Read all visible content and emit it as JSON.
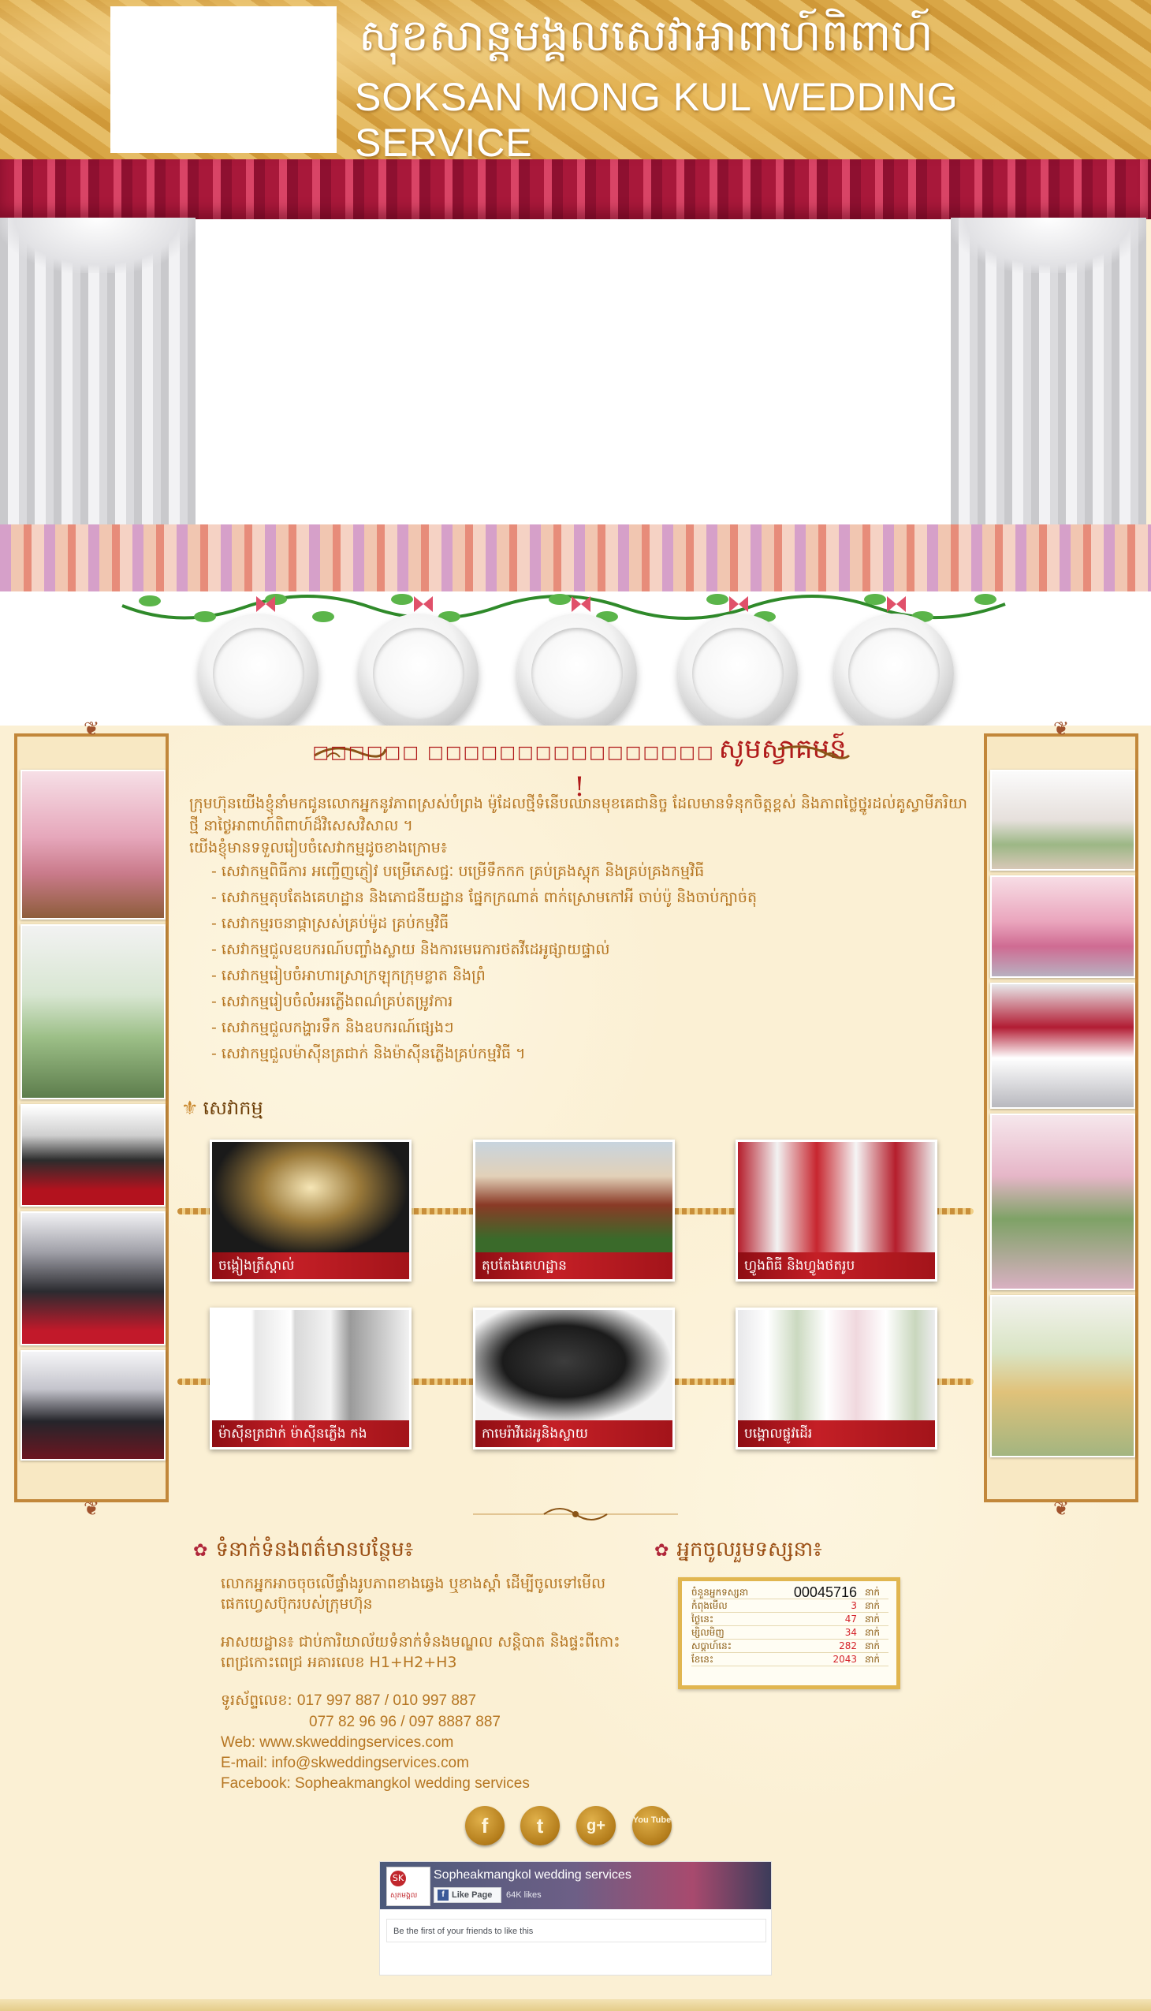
{
  "header": {
    "title_km": "សុខសាន្តមង្គលសេវាអាពាហ៍ពិពាហ៍",
    "title_en": "SOKSAN MONG KUL WEDDING SERVICE"
  },
  "nav_buttons": [
    "",
    "",
    "",
    "",
    ""
  ],
  "welcome": {
    "prefix": "□□□□□□ □□□□□□□□□□□□□□□□",
    "main": "សូមស្វាគមន៍ !"
  },
  "intro": {
    "paragraph": "ក្រុមហ៊ុនយើងខ្ញុំនាំមកជូនលោកអ្នកនូវភាពស្រស់បំព្រង ម៉ូដែលថ្មីទំនើបឈានមុខគេជានិច្ច ដែលមានទំនុកចិត្តខ្ពស់ និងភាពថ្លៃថ្នូរដល់គូស្វាមីភរិយាថ្មី នាថ្ងៃអាពាហ៍ពិពាហ៍ដ៏វិសេសវិសាល ។",
    "lead": "យើងខ្ញុំមានទទួលរៀបចំសេវាកម្មដូចខាងក្រោម៖",
    "items": [
      "- សេវាកម្មពិធីការ អញ្ជើញភ្ញៀវ បម្រើភេសជ្ជៈ បម្រើទឹកកក គ្រប់គ្រងស្តុក និងគ្រប់គ្រងកម្មវិធី",
      "- សេវាកម្មតុបតែងគេហដ្ឋាន និងភោជនីយដ្ឋាន ផ្នែកក្រណាត់ ពាក់ស្រោមកៅអី ចាប់ប៉ូ និងចាប់ក្បាច់តុ",
      "- សេវាកម្មរចនាផ្កាស្រស់គ្រប់ម៉ូដ គ្រប់កម្មវិធី",
      "- សេវាកម្មជួលឧបករណ៍បញ្ចាំងស្លាយ និងការមេរេ​ការថតវីដេអូផ្សាយផ្ទាល់",
      "- សេវាកម្មរៀបចំអាហារស្រាក្រឡុកក្រុមខ្លាត និងព្រំ",
      "- សេវាកម្មរៀបចំលំអរភ្លើងពណ៌គ្រប់តម្រូវការ",
      "- សេវាកម្មជួលកង្ហារទឹក និងឧបករណ៍ផ្សេងៗ",
      "- សេវាកម្មជួលម៉ាស៊ីនត្រជាក់ និងម៉ាស៊ីនភ្លើងគ្រប់កម្មវិធី ។"
    ]
  },
  "services": {
    "heading": "សេវាកម្ម",
    "cards": [
      {
        "label": "ចង្កៀងត្រីស្តាល់"
      },
      {
        "label": "តុបតែងគេហដ្ឋាន"
      },
      {
        "label": "ហ្វូងពិធី និងហ្វូងថតរូប"
      },
      {
        "label": "ម៉ាស៊ីនត្រជាក់ ម៉ាស៊ីនភ្លើង កង"
      },
      {
        "label": "កាមេរ៉ាវីដេអូនិងស្លាយ"
      },
      {
        "label": "បង្គោលផ្លូវដើរ"
      }
    ]
  },
  "contact": {
    "heading": "ទំនាក់ទំនងពត៌មានបន្ថែម៖",
    "note": "លោកអ្នកអាចចុចលើផ្ទាំងរូបភាពខាងឆ្វេង ឬខាងស្តាំ ដើម្បីចូលទៅមើល ផេកហ្វេសប៊ុករបស់ក្រុមហ៊ុន",
    "address": "អាសយដ្ឋាន៖ ជាប់ការិយាល័យទំនាក់ទំនងមណ្ឌល សន្តិបាត និងផ្ទះពីកោះពេជ្រកោះពេជ្រ អគារលេខ H1+H2+H3",
    "phone_label": "ទូរស័ព្ទលេខ:",
    "phone1": "017 997 887 / 010 997 887",
    "phone2": "077 82 96 96 / 097 8887 887",
    "web": "Web: www.skweddingservices.com",
    "email": "E-mail: info@skweddingservices.com",
    "facebook": "Facebook: Sopheakmangkol wedding services"
  },
  "visitors": {
    "heading": "អ្នកចូលរួមទស្សនា៖",
    "rows": [
      {
        "label": "ចំនួនអ្នកទស្សនា",
        "value": "00045716",
        "unit": "នាក់"
      },
      {
        "label": "កំពុងមើល",
        "value": "3",
        "unit": "នាក់"
      },
      {
        "label": "ថ្ងៃនេះ",
        "value": "47",
        "unit": "នាក់"
      },
      {
        "label": "ម្សិលមិញ",
        "value": "34",
        "unit": "នាក់"
      },
      {
        "label": "សប្តាហ៍នេះ",
        "value": "282",
        "unit": "នាក់"
      },
      {
        "label": "ខែនេះ",
        "value": "2043",
        "unit": "នាក់"
      }
    ]
  },
  "social": {
    "facebook": "f",
    "twitter": "t",
    "google": "g+",
    "youtube": "You Tube"
  },
  "fb_widget": {
    "page_name": "Sopheakmangkol wedding services",
    "like_label": "Like Page",
    "likes": "64K likes",
    "logo_text": "សុភមង្គល",
    "logo_mark": "SK",
    "friends_text": "Be the first of your friends to like this"
  },
  "colors": {
    "curtain_red": "#a8183a",
    "label_red": "#c41f26",
    "heading_red": "#b01a1a",
    "gold_text": "#b57521",
    "background_cream": "#fbf0d4"
  }
}
